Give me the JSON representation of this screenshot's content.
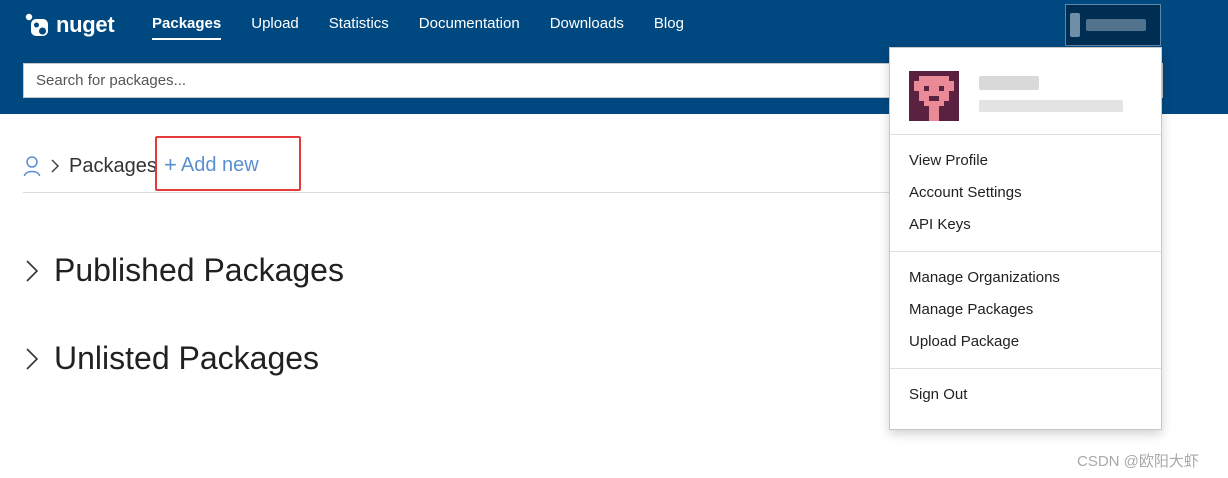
{
  "brand": {
    "name": "nuget"
  },
  "nav": {
    "items": [
      {
        "label": "Packages",
        "active": true
      },
      {
        "label": "Upload",
        "active": false
      },
      {
        "label": "Statistics",
        "active": false
      },
      {
        "label": "Documentation",
        "active": false
      },
      {
        "label": "Downloads",
        "active": false
      },
      {
        "label": "Blog",
        "active": false
      }
    ]
  },
  "search": {
    "placeholder": "Search for packages...",
    "value": ""
  },
  "breadcrumb": {
    "current": "Packages",
    "add_new": "Add new"
  },
  "sections": {
    "published": "Published Packages",
    "unlisted": "Unlisted Packages"
  },
  "account_menu": {
    "group1": [
      "View Profile",
      "Account Settings",
      "API Keys"
    ],
    "group2": [
      "Manage Organizations",
      "Manage Packages",
      "Upload Package"
    ],
    "group3": [
      "Sign Out"
    ]
  },
  "icons": {
    "logo": "nuget-logo-icon",
    "user": "user-icon",
    "chevron": "chevron-right-icon",
    "plus": "plus-icon"
  },
  "colors": {
    "header_bg": "#004880",
    "accent_link": "#5a8fd1",
    "highlight_box": "#e33a3a"
  },
  "watermark": "CSDN @欧阳大虾"
}
